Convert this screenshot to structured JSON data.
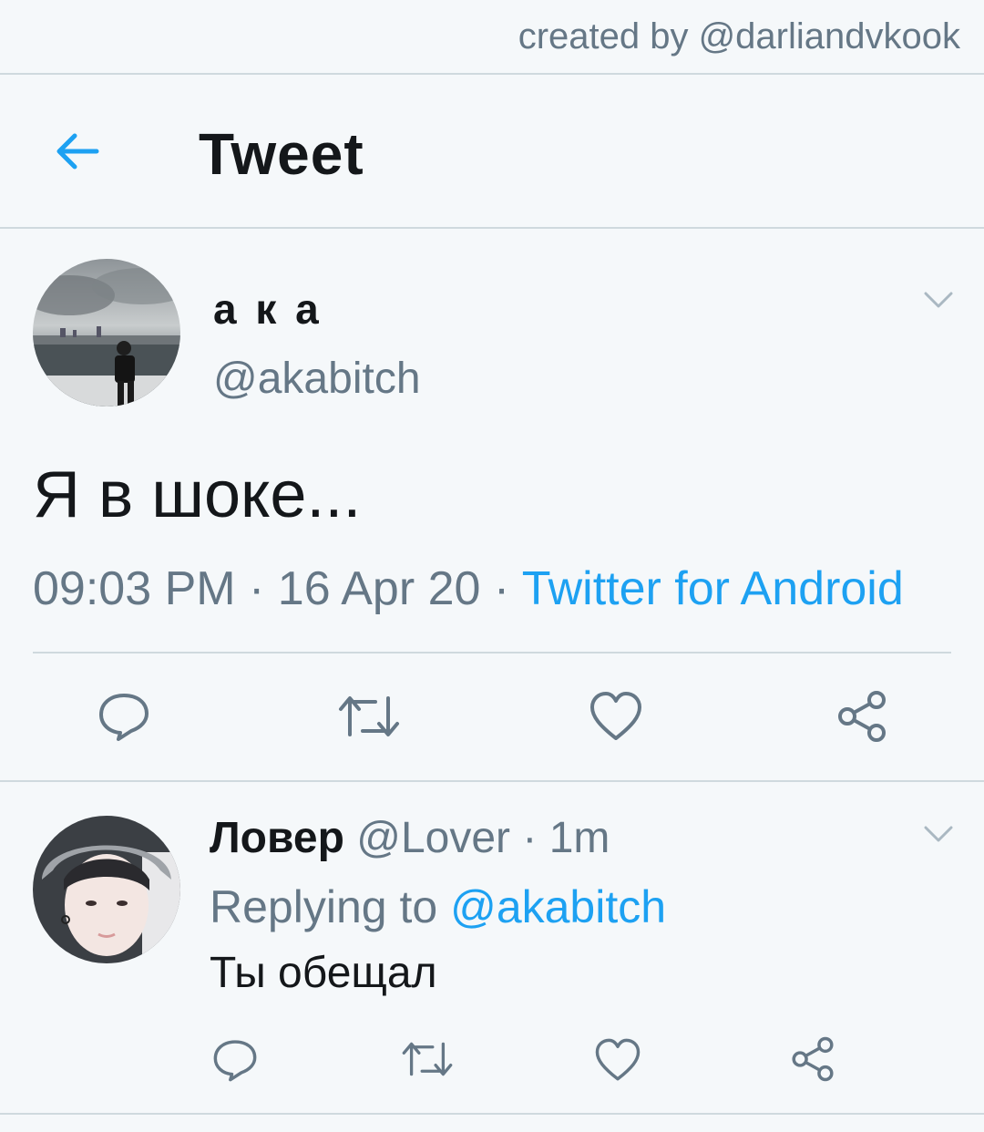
{
  "credit": "created by @darliandvkook",
  "header": {
    "back_icon": "arrow-left-icon",
    "title": "Tweet"
  },
  "tweet": {
    "name": "а к а",
    "handle": "@akabitch",
    "text": "Я в шоке...",
    "time": "09:03 PM",
    "date": "16 Apr 20",
    "source": "Twitter for Android",
    "actions": [
      "reply-icon",
      "retweet-icon",
      "heart-icon",
      "share-icon"
    ]
  },
  "reply": {
    "name": "Ловер",
    "handle": "@Lover",
    "time": "1m",
    "replying_prefix": "Replying to",
    "replying_to": "@akabitch",
    "text": "Ты обещал",
    "actions": [
      "reply-icon",
      "retweet-icon",
      "heart-icon",
      "share-icon"
    ]
  },
  "colors": {
    "accent": "#1da1f2",
    "muted": "#657786",
    "text": "#14171a",
    "background": "#f5f8fa"
  }
}
